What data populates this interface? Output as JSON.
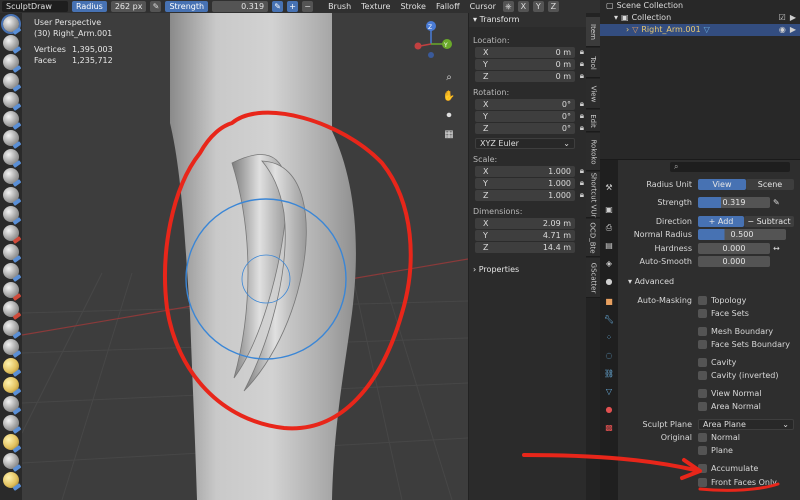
{
  "header": {
    "mode_name": "SculptDraw",
    "radius_label": "Radius",
    "radius_value": "262 px",
    "strength_label": "Strength",
    "strength_value": "0.319",
    "menus": [
      "Brush",
      "Texture",
      "Stroke",
      "Falloff",
      "Cursor"
    ],
    "mirror_axes": [
      "X",
      "Y",
      "Z"
    ]
  },
  "viewport": {
    "view_name": "User Perspective",
    "object_line": "(30) Right_Arm.001",
    "stats": [
      {
        "label": "Vertices",
        "value": "1,395,003"
      },
      {
        "label": "Faces",
        "value": "1,235,712"
      }
    ],
    "gizmo_labels": {
      "z": "Z",
      "y": "Y"
    }
  },
  "npanel": {
    "transform_title": "Transform",
    "location_label": "Location:",
    "location": [
      {
        "axis": "X",
        "value": "0 m"
      },
      {
        "axis": "Y",
        "value": "0 m"
      },
      {
        "axis": "Z",
        "value": "0 m"
      }
    ],
    "rotation_label": "Rotation:",
    "rotation": [
      {
        "axis": "X",
        "value": "0°"
      },
      {
        "axis": "Y",
        "value": "0°"
      },
      {
        "axis": "Z",
        "value": "0°"
      }
    ],
    "rotation_mode": "XYZ Euler",
    "scale_label": "Scale:",
    "scale": [
      {
        "axis": "X",
        "value": "1.000"
      },
      {
        "axis": "Y",
        "value": "1.000"
      },
      {
        "axis": "Z",
        "value": "1.000"
      }
    ],
    "dimensions_label": "Dimensions:",
    "dimensions": [
      {
        "axis": "X",
        "value": "2.09 m"
      },
      {
        "axis": "Y",
        "value": "4.71 m"
      },
      {
        "axis": "Z",
        "value": "14.4 m"
      }
    ],
    "properties_title": "Properties"
  },
  "tabs": [
    "Item",
    "Tool",
    "View",
    "Edit",
    "Rokoko",
    "Shortcut VUr",
    "OCD_Bte",
    "GScatter"
  ],
  "outliner": {
    "scene_collection": "Scene Collection",
    "collection": "Collection",
    "object": "Right_Arm.001"
  },
  "properties": {
    "radius_unit_label": "Radius Unit",
    "radius_unit_options": [
      "View",
      "Scene"
    ],
    "strength_label": "Strength",
    "strength_value": "0.319",
    "direction_label": "Direction",
    "direction_add": "Add",
    "direction_subtract": "Subtract",
    "normal_radius_label": "Normal Radius",
    "normal_radius_value": "0.500",
    "hardness_label": "Hardness",
    "hardness_value": "0.000",
    "auto_smooth_label": "Auto-Smooth",
    "auto_smooth_value": "0.000",
    "advanced_title": "Advanced",
    "auto_masking_label": "Auto-Masking",
    "auto_masking": [
      "Topology",
      "Face Sets",
      "Mesh Boundary",
      "Face Sets Boundary",
      "Cavity",
      "Cavity (inverted)",
      "View Normal",
      "Area Normal"
    ],
    "sculpt_plane_label": "Sculpt Plane",
    "sculpt_plane_value": "Area Plane",
    "original_label": "Original",
    "original_options": [
      "Normal",
      "Plane"
    ],
    "accumulate_label": "Accumulate",
    "front_faces_label": "Front Faces Only"
  },
  "colors": {
    "accent": "#4772b3",
    "annotation": "#e8261a",
    "brush_circle": "#3a86d6"
  }
}
